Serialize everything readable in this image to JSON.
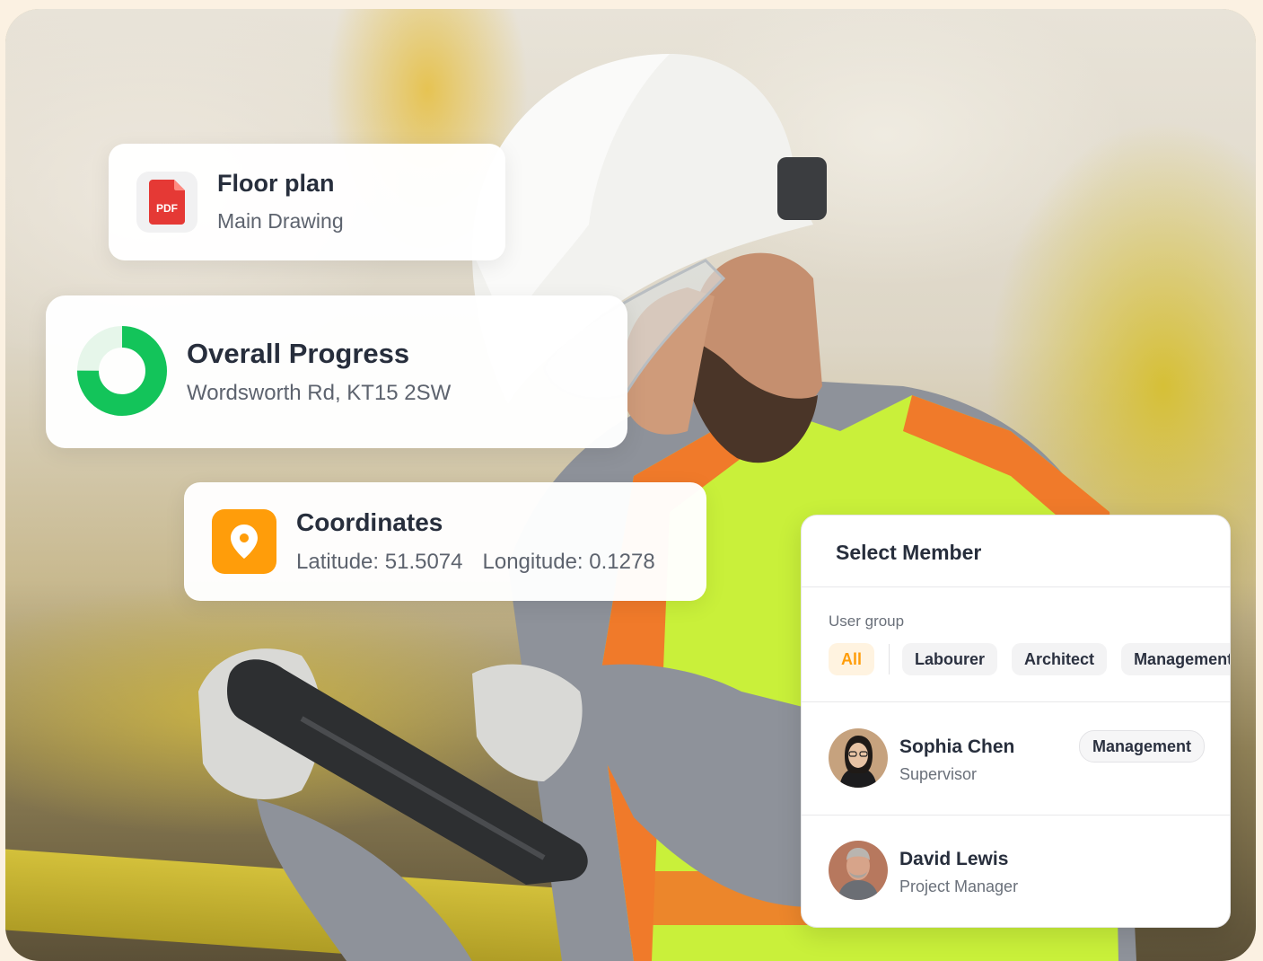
{
  "floor_card": {
    "file_badge": "PDF",
    "title": "Floor plan",
    "subtitle": "Main Drawing",
    "icon": "pdf-file-icon"
  },
  "progress_card": {
    "title": "Overall Progress",
    "address": "Wordsworth Rd, KT15 2SW",
    "progress_fraction": 0.75,
    "colors": {
      "complete": "#13c45a",
      "remaining": "#e6f6ea"
    }
  },
  "coords_card": {
    "title": "Coordinates",
    "latitude_label": "Latitude: 51.5074",
    "longitude_label": "Longitude: 0.1278",
    "icon": "map-pin-icon",
    "accent": "#ff9d0a"
  },
  "member_panel": {
    "title": "Select Member",
    "user_group_label": "User group",
    "groups": [
      {
        "label": "All",
        "active": true
      },
      {
        "label": "Labourer",
        "active": false
      },
      {
        "label": "Architect",
        "active": false
      },
      {
        "label": "Management",
        "active": false
      }
    ],
    "members": [
      {
        "name": "Sophia Chen",
        "role": "Supervisor",
        "badge": "Management"
      },
      {
        "name": "David Lewis",
        "role": "Project Manager",
        "badge": ""
      }
    ]
  }
}
